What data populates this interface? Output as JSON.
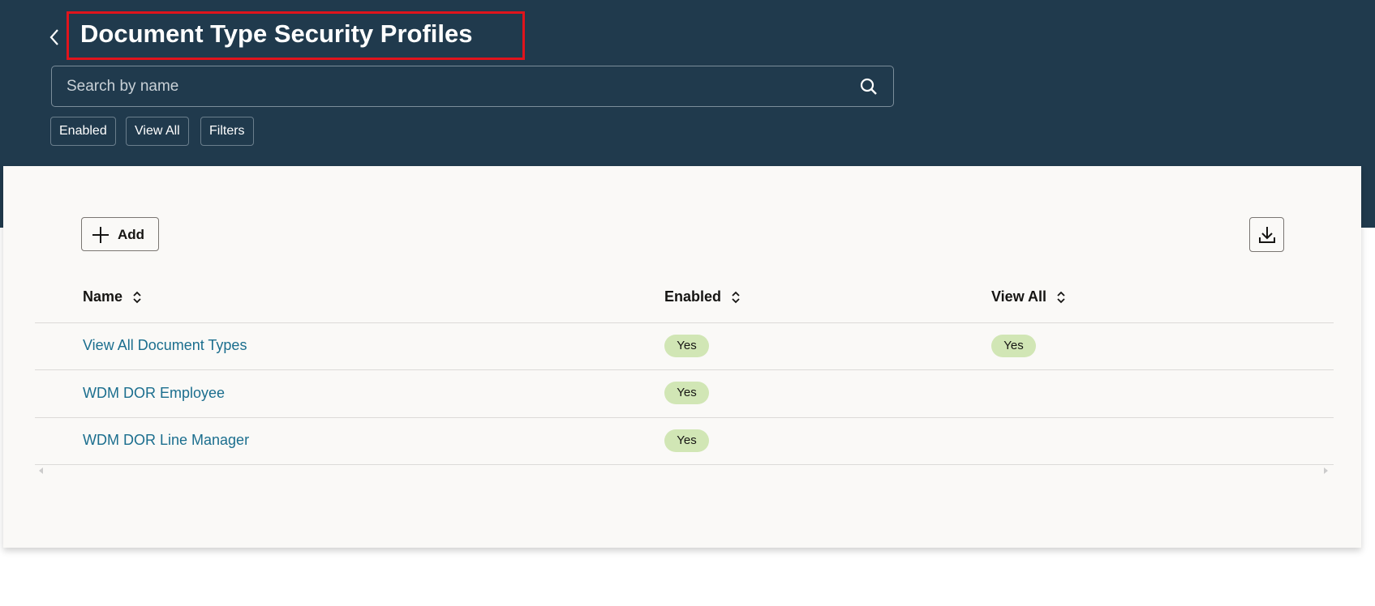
{
  "header": {
    "title": "Document Type Security Profiles",
    "back_label": "Back"
  },
  "search": {
    "placeholder": "Search by name",
    "value": ""
  },
  "filter_chips": [
    "Enabled",
    "View All",
    "Filters"
  ],
  "toolbar": {
    "add_label": "Add"
  },
  "table": {
    "columns": [
      "Name",
      "Enabled",
      "View All"
    ],
    "rows": [
      {
        "name": "View All Document Types",
        "enabled": "Yes",
        "view_all": "Yes"
      },
      {
        "name": "WDM DOR Employee",
        "enabled": "Yes",
        "view_all": ""
      },
      {
        "name": "WDM DOR Line Manager",
        "enabled": "Yes",
        "view_all": ""
      }
    ]
  },
  "colors": {
    "header_bg": "#203a4d",
    "highlight": "#e0141c",
    "link": "#1b6e8e",
    "badge": "#d1e6b5"
  }
}
